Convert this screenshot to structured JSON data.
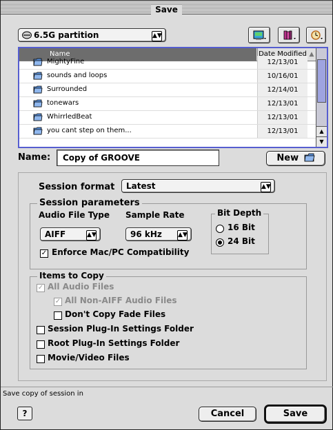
{
  "window": {
    "title": "Save"
  },
  "location": {
    "selected": "6.5G partition"
  },
  "file_list": {
    "columns": {
      "name": "Name",
      "date": "Date Modified"
    },
    "rows": [
      {
        "name": "MightyFine",
        "date": "12/13/01"
      },
      {
        "name": "sounds and loops",
        "date": "10/16/01"
      },
      {
        "name": "Surrounded",
        "date": "12/14/01"
      },
      {
        "name": "tonewars",
        "date": "12/13/01"
      },
      {
        "name": "WhirrledBeat",
        "date": "12/13/01"
      },
      {
        "name": "you cant step on them...",
        "date": "12/13/01"
      }
    ]
  },
  "name_field": {
    "label": "Name:",
    "value": "Copy of GROOVE"
  },
  "new_button": {
    "label": "New"
  },
  "session_format": {
    "label": "Session format",
    "value": "Latest"
  },
  "session_parameters": {
    "title": "Session parameters",
    "audio_file_type": {
      "label": "Audio File Type",
      "value": "AIFF"
    },
    "sample_rate": {
      "label": "Sample Rate",
      "value": "96 kHz"
    },
    "bit_depth": {
      "title": "Bit Depth",
      "options": [
        "16 Bit",
        "24 Bit"
      ],
      "selected": "24 Bit"
    },
    "enforce": {
      "label": "Enforce Mac/PC Compatibility",
      "checked": true
    }
  },
  "items_to_copy": {
    "title": "Items to Copy",
    "items": [
      {
        "label": "All Audio Files",
        "checked": true,
        "enabled": false
      },
      {
        "label": "All Non-AIFF Audio Files",
        "checked": true,
        "enabled": false
      },
      {
        "label": "Don't Copy Fade Files",
        "checked": false,
        "enabled": true
      },
      {
        "label": "Session Plug-In Settings Folder",
        "checked": false,
        "enabled": true
      },
      {
        "label": "Root Plug-In Settings Folder",
        "checked": false,
        "enabled": true
      },
      {
        "label": "Movie/Video Files",
        "checked": false,
        "enabled": true
      }
    ]
  },
  "status_text": "Save copy of session in",
  "buttons": {
    "help": "?",
    "cancel": "Cancel",
    "save": "Save"
  },
  "icons": {
    "drive": "drive-icon",
    "desktop": "desktop-icon",
    "favorites": "favorites-icon",
    "recent": "recent-clock-icon",
    "folder": "folder-icon",
    "new_folder": "new-folder-icon"
  },
  "colors": {
    "list_focus": "#555dd0",
    "scroll_thumb": "#9fa4e0",
    "folder": "#5b8fd6",
    "header_selected": "#6d6d6d"
  }
}
